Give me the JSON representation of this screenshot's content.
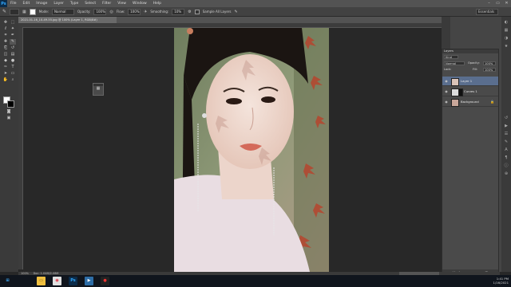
{
  "app": {
    "logo": "Ps",
    "menu": [
      "File",
      "Edit",
      "Image",
      "Layer",
      "Type",
      "Select",
      "Filter",
      "View",
      "Window",
      "Help"
    ],
    "window_controls": [
      "–",
      "▭",
      "✕"
    ]
  },
  "options_bar": {
    "mode_label": "Mode:",
    "mode_value": "Normal",
    "opacity_label": "Opacity:",
    "opacity_value": "100%",
    "flow_label": "Flow:",
    "flow_value": "100%",
    "smoothing_label": "Smoothing:",
    "smoothing_value": "10%",
    "sample_label": "Sample All Layers",
    "workspace": "Essentials"
  },
  "document": {
    "tab_title": "2021-01-16_10-49-55.jpg @ 100% (Layer 1, RGB/8#)",
    "zoom": "100%",
    "doc_info": "Doc: 1.04M/2.08M"
  },
  "layers_panel": {
    "tab_label": "Layers",
    "kind_label": "Kind",
    "blend_mode": "Normal",
    "opacity_label": "Opacity:",
    "opacity_value": "100%",
    "lock_label": "Lock:",
    "fill_label": "Fill:",
    "fill_value": "100%",
    "layers": [
      {
        "name": "Layer 1",
        "selected": true
      },
      {
        "name": "Curves 1",
        "selected": false
      },
      {
        "name": "Background",
        "selected": false
      }
    ],
    "footer_icons": [
      "link-icon",
      "fx-icon",
      "mask-icon",
      "adjustment-icon",
      "folder-icon",
      "new-layer-icon",
      "trash-icon"
    ]
  },
  "taskbar": {
    "time": "1:41 PM",
    "date": "1/16/2021",
    "apps": [
      "windows-start-icon",
      "file-explorer-icon",
      "chrome-icon",
      "photoshop-icon",
      "media-icon",
      "recorder-icon"
    ]
  },
  "colors": {
    "accent_selection": "#5a6e8e",
    "ps_blue": "#31a8ff"
  }
}
